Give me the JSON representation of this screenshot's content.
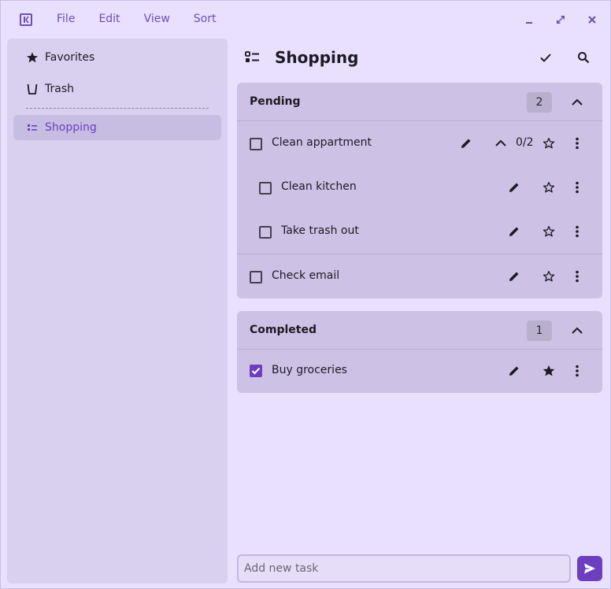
{
  "menu": {
    "file": "File",
    "edit": "Edit",
    "view": "View",
    "sort": "Sort"
  },
  "sidebar": {
    "items": [
      {
        "label": "Favorites",
        "icon": "star-icon"
      },
      {
        "label": "Trash",
        "icon": "trash-icon"
      },
      {
        "label": "Shopping",
        "icon": "list-icon",
        "active": true
      }
    ]
  },
  "main": {
    "title": "Shopping",
    "groups": [
      {
        "title": "Pending",
        "count": "2",
        "tasks": [
          {
            "label": "Clean appartment",
            "subtasks": "0/2",
            "checked": false,
            "favorite": false
          },
          {
            "label": "Clean kitchen",
            "checked": false,
            "favorite": false,
            "subtask": true
          },
          {
            "label": "Take trash out",
            "checked": false,
            "favorite": false,
            "subtask": true
          },
          {
            "label": "Check email",
            "checked": false,
            "favorite": false
          }
        ]
      },
      {
        "title": "Completed",
        "count": "1",
        "tasks": [
          {
            "label": "Buy groceries",
            "checked": true,
            "favorite": true
          }
        ]
      }
    ]
  },
  "add_task": {
    "placeholder": "Add new task"
  },
  "colors": {
    "accent": "#6d3fc0",
    "background": "#e8e0fd",
    "sidebar": "#d9cfef",
    "group": "#cdc2e5"
  }
}
